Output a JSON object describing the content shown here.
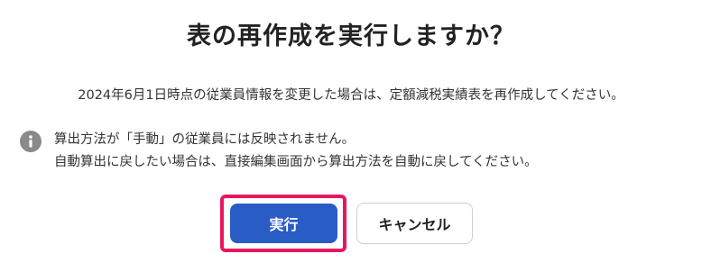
{
  "dialog": {
    "title": "表の再作成を実行しますか？",
    "message": "2024年6月1日時点の従業員情報を変更した場合は、定額減税実績表を再作成してください。",
    "notice": {
      "icon": "info-icon",
      "line1": "算出方法が「手動」の従業員には反映されません。",
      "line2": "自動算出に戻したい場合は、直接編集画面から算出方法を自動に戻してください。"
    },
    "buttons": {
      "execute_label": "実行",
      "cancel_label": "キャンセル"
    }
  },
  "colors": {
    "primary": "#2a5cc6",
    "highlight": "#e8175d",
    "icon": "#8a8a8a"
  }
}
